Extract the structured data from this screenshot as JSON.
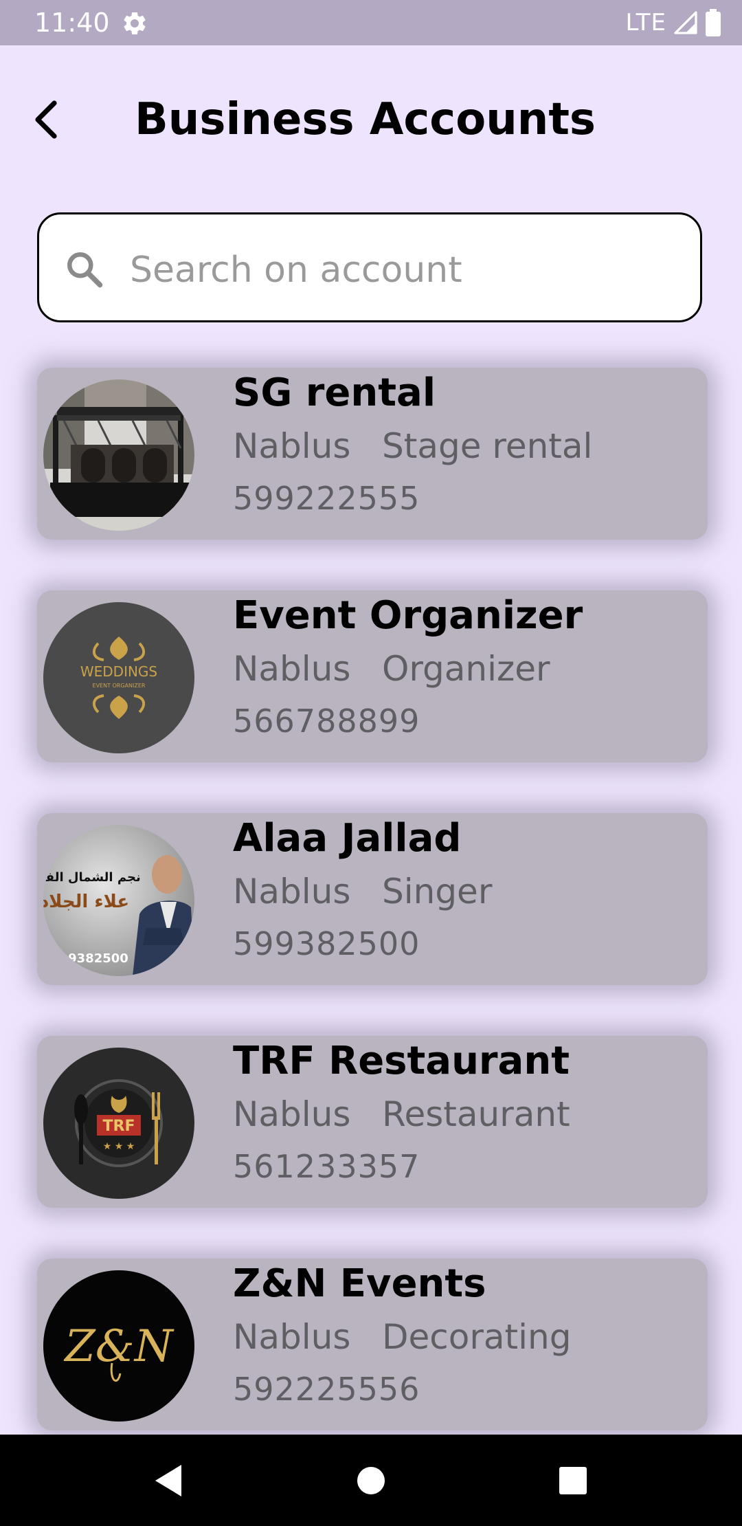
{
  "status_bar": {
    "time": "11:40",
    "network": "LTE",
    "icons": [
      "settings-gear-icon",
      "signal-icon",
      "battery-icon"
    ]
  },
  "header": {
    "back_icon": "chevron-left-icon",
    "title": "Business Accounts"
  },
  "search": {
    "icon": "search-icon",
    "placeholder": "Search on account",
    "value": ""
  },
  "accounts": [
    {
      "name": "SG rental",
      "city": "Nablus",
      "category": "Stage rental",
      "phone": "599222555",
      "avatar": "stage-photo"
    },
    {
      "name": "Event Organizer",
      "city": "Nablus",
      "category": "Organizer",
      "phone": "566788899",
      "avatar": "weddings-logo",
      "avatar_text": "WEDDINGS",
      "avatar_subtext": "EVENT ORGANIZER"
    },
    {
      "name": "Alaa Jallad",
      "city": "Nablus",
      "category": "Singer",
      "phone": "599382500",
      "avatar": "singer-photo",
      "avatar_text": "نجم الشمال الفنان",
      "avatar_text2": "علاء الجلاد",
      "avatar_number": "9382500"
    },
    {
      "name": "TRF Restaurant",
      "city": "Nablus",
      "category": "Restaurant",
      "phone": "561233357",
      "avatar": "restaurant-logo",
      "avatar_text": "TRF"
    },
    {
      "name": "Z&N Events",
      "city": "Nablus",
      "category": "Decorating",
      "phone": "592225556",
      "avatar": "zn-logo",
      "avatar_text": "Z&N"
    }
  ],
  "colors": {
    "background": "#EEE4FD",
    "status_bar": "#B3A9C3",
    "card": "#B9B4C0",
    "secondary_text": "#5E5E63",
    "gold": "#C9A24A"
  },
  "nav_bar": {
    "icons": [
      "nav-back-icon",
      "nav-home-icon",
      "nav-recents-icon"
    ]
  }
}
